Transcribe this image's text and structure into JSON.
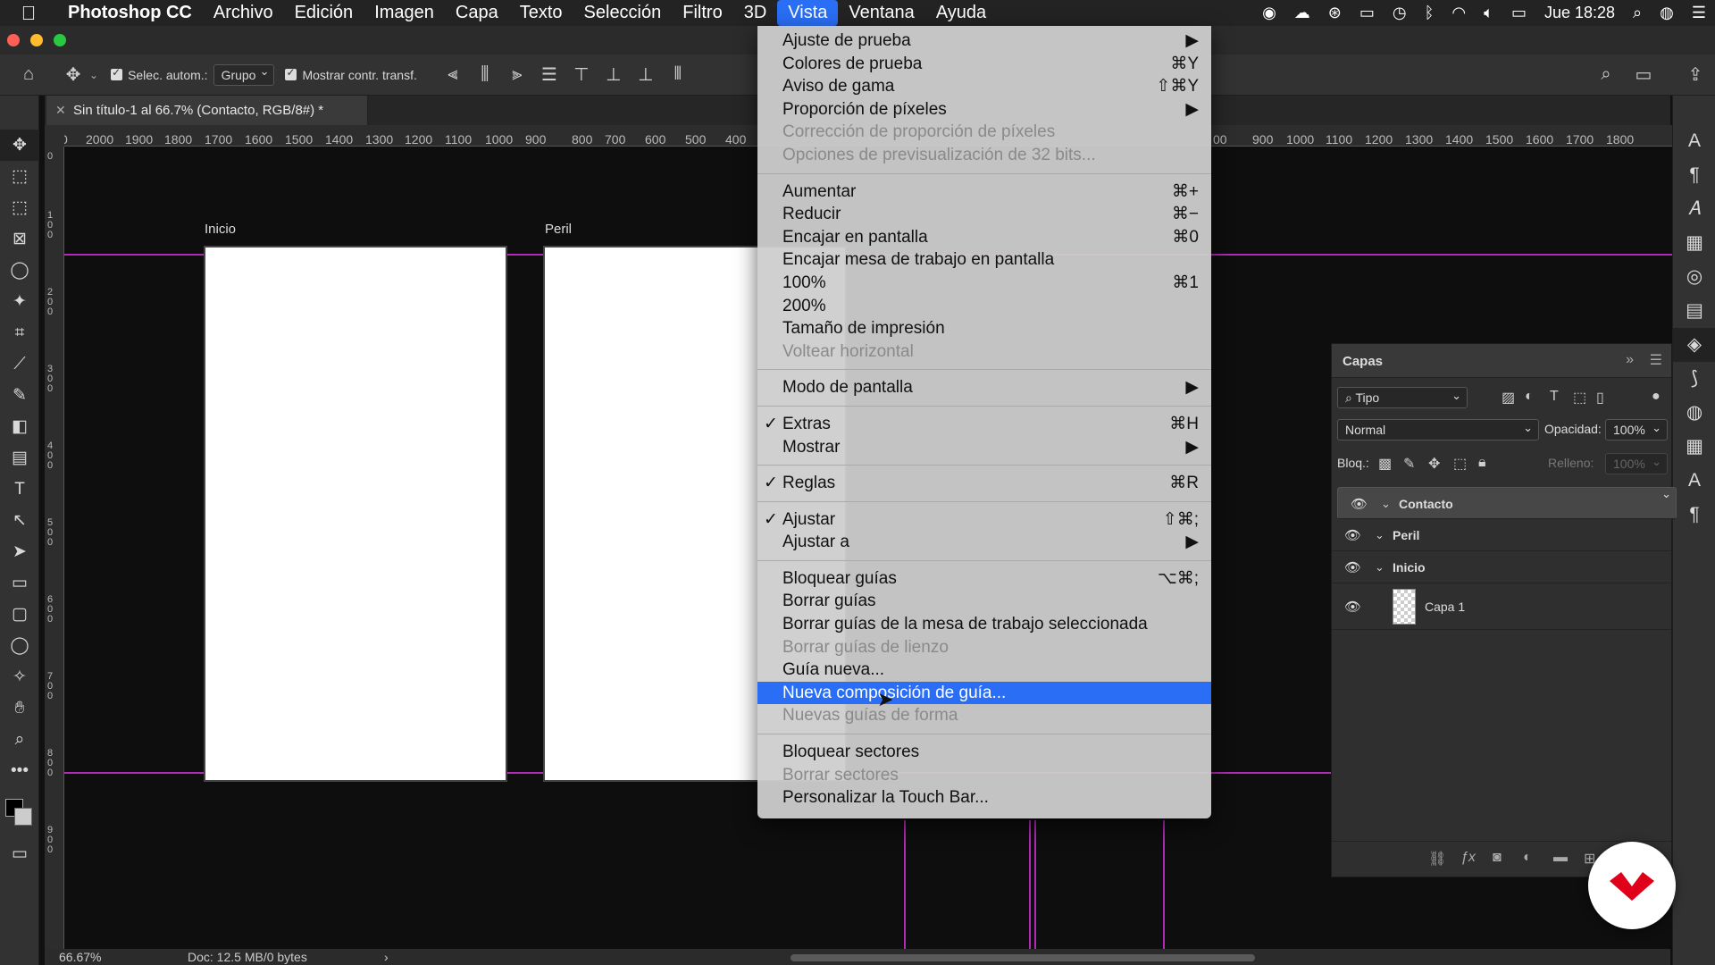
{
  "menubar": {
    "app": "Photoshop CC",
    "items": [
      "Archivo",
      "Edición",
      "Imagen",
      "Capa",
      "Texto",
      "Selección",
      "Filtro",
      "3D",
      "Vista",
      "Ventana",
      "Ayuda"
    ],
    "active": "Vista",
    "clock": "Jue 18:28"
  },
  "options_bar": {
    "auto_select_label": "Selec. autom.:",
    "auto_select_value": "Grupo",
    "show_transform_label": "Mostrar contr. transf."
  },
  "document_tab": {
    "title": "Sin título-1 al 66.7% (Contacto, RGB/8#) *"
  },
  "ruler_h": [
    "0",
    "2000",
    "1900",
    "1800",
    "1700",
    "1600",
    "1500",
    "1400",
    "1300",
    "1200",
    "1100",
    "1000",
    "900",
    "800",
    "700",
    "600",
    "500",
    "400",
    "00",
    "900",
    "1000",
    "1100",
    "1200",
    "1300",
    "1400",
    "1500",
    "1600",
    "1700",
    "1800"
  ],
  "ruler_v": [
    "0",
    "100",
    "200",
    "300",
    "400",
    "500",
    "600",
    "700",
    "800",
    "900"
  ],
  "artboards": {
    "first": "Inicio",
    "second": "Peril"
  },
  "status": {
    "zoom": "66.67%",
    "doc": "Doc: 12.5 MB/0 bytes"
  },
  "layers_panel": {
    "title": "Capas",
    "filter": "Tipo",
    "blend_mode": "Normal",
    "opacity_label": "Opacidad:",
    "opacity_value": "100%",
    "lock_label": "Bloq.:",
    "fill_label": "Relleno:",
    "fill_value": "100%",
    "layers": [
      {
        "name": "Contacto",
        "type": "group",
        "selected": true
      },
      {
        "name": "Peril",
        "type": "group",
        "selected": false
      },
      {
        "name": "Inicio",
        "type": "group",
        "selected": false
      },
      {
        "name": "Capa 1",
        "type": "layer",
        "selected": false
      }
    ]
  },
  "vista_menu": {
    "sections": [
      [
        {
          "label": "Ajuste de prueba",
          "shortcut": "▶",
          "disabled": false
        },
        {
          "label": "Colores de prueba",
          "shortcut": "⌘Y",
          "disabled": false
        },
        {
          "label": "Aviso de gama",
          "shortcut": "⇧⌘Y",
          "disabled": false
        },
        {
          "label": "Proporción de píxeles",
          "shortcut": "▶",
          "disabled": false
        },
        {
          "label": "Corrección de proporción de píxeles",
          "shortcut": "",
          "disabled": true
        },
        {
          "label": "Opciones de previsualización de 32 bits...",
          "shortcut": "",
          "disabled": true
        }
      ],
      [
        {
          "label": "Aumentar",
          "shortcut": "⌘+",
          "disabled": false
        },
        {
          "label": "Reducir",
          "shortcut": "⌘−",
          "disabled": false
        },
        {
          "label": "Encajar en pantalla",
          "shortcut": "⌘0",
          "disabled": false
        },
        {
          "label": "Encajar mesa de trabajo en pantalla",
          "shortcut": "",
          "disabled": false
        },
        {
          "label": "100%",
          "shortcut": "⌘1",
          "disabled": false
        },
        {
          "label": "200%",
          "shortcut": "",
          "disabled": false
        },
        {
          "label": "Tamaño de impresión",
          "shortcut": "",
          "disabled": false
        },
        {
          "label": "Voltear horizontal",
          "shortcut": "",
          "disabled": true
        }
      ],
      [
        {
          "label": "Modo de pantalla",
          "shortcut": "▶",
          "disabled": false
        }
      ],
      [
        {
          "label": "Extras",
          "shortcut": "⌘H",
          "disabled": false,
          "checked": true
        },
        {
          "label": "Mostrar",
          "shortcut": "▶",
          "disabled": false
        }
      ],
      [
        {
          "label": "Reglas",
          "shortcut": "⌘R",
          "disabled": false,
          "checked": true
        }
      ],
      [
        {
          "label": "Ajustar",
          "shortcut": "⇧⌘;",
          "disabled": false,
          "checked": true
        },
        {
          "label": "Ajustar a",
          "shortcut": "▶",
          "disabled": false
        }
      ],
      [
        {
          "label": "Bloquear guías",
          "shortcut": "⌥⌘;",
          "disabled": false
        },
        {
          "label": "Borrar guías",
          "shortcut": "",
          "disabled": false
        },
        {
          "label": "Borrar guías de la mesa de trabajo seleccionada",
          "shortcut": "",
          "disabled": false
        },
        {
          "label": "Borrar guías de lienzo",
          "shortcut": "",
          "disabled": true
        },
        {
          "label": "Guía nueva...",
          "shortcut": "",
          "disabled": false
        },
        {
          "label": "Nueva composición de guía...",
          "shortcut": "",
          "disabled": false,
          "highlighted": true
        },
        {
          "label": "Nuevas guías de forma",
          "shortcut": "",
          "disabled": true
        }
      ],
      [
        {
          "label": "Bloquear sectores",
          "shortcut": "",
          "disabled": false
        },
        {
          "label": "Borrar sectores",
          "shortcut": "",
          "disabled": true
        },
        {
          "label": "Personalizar la Touch Bar...",
          "shortcut": "",
          "disabled": false
        }
      ]
    ]
  },
  "colors": {
    "accent": "#2a6ef5",
    "guide": "#b12bb6",
    "badge_red": "#e1001a"
  }
}
